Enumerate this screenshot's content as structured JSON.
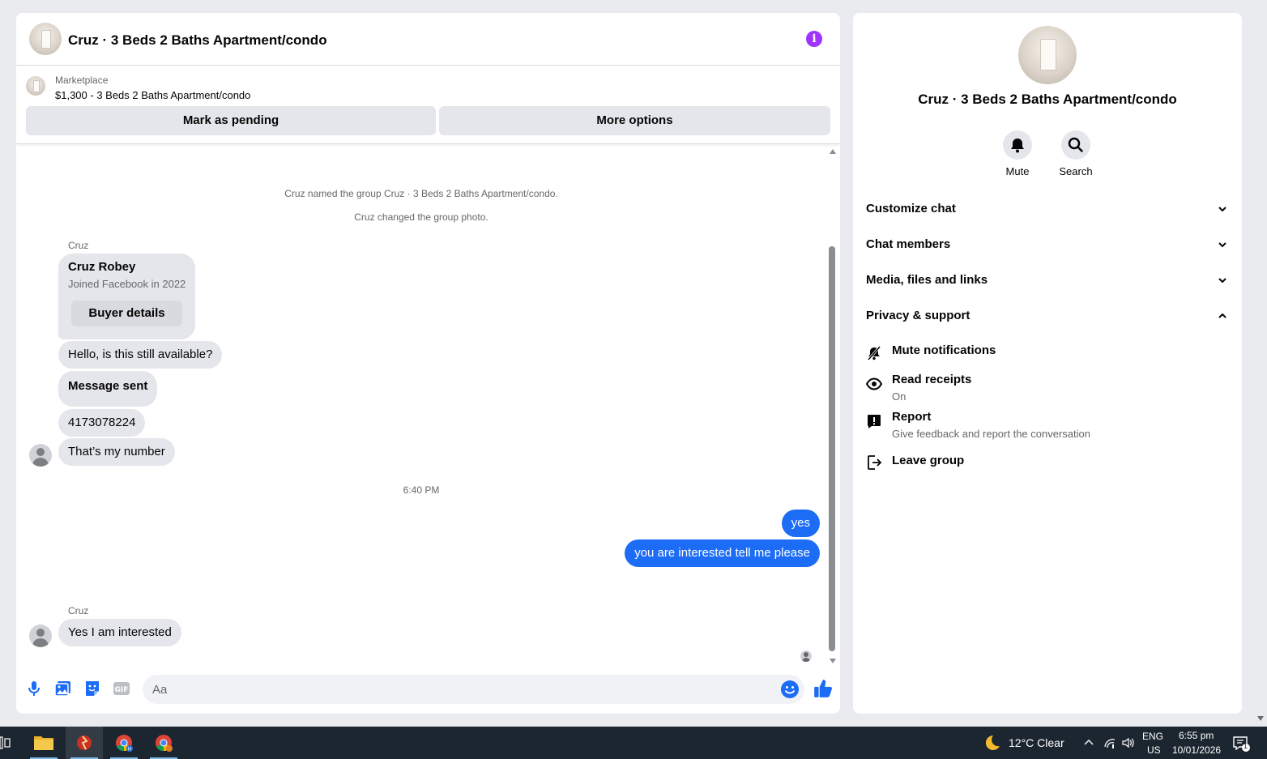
{
  "chat": {
    "title": "Cruz · 3 Beds 2 Baths Apartment/condo",
    "marketplace_label": "Marketplace",
    "listing": "$1,300 - 3 Beds 2 Baths Apartment/condo",
    "mark_pending_label": "Mark as pending",
    "more_options_label": "More options",
    "system_messages": [
      "Cruz named the group Cruz · 3 Beds 2 Baths Apartment/condo.",
      "Cruz changed the group photo."
    ],
    "sender_name": "Cruz",
    "profile_card": {
      "name": "Cruz Robey",
      "joined": "Joined Facebook in 2022",
      "button": "Buyer details"
    },
    "incoming_messages": [
      "Hello, is this still available?",
      "Message sent",
      "4173078224",
      "That’s my number"
    ],
    "timestamp": "6:40 PM",
    "outgoing_messages": [
      "yes",
      "you are interested tell me please"
    ],
    "last_sender_name": "Cruz",
    "last_message": "Yes I am interested",
    "composer_placeholder": "Aa"
  },
  "info_panel": {
    "title": "Cruz · 3 Beds 2 Baths Apartment/condo",
    "mute_label": "Mute",
    "search_label": "Search",
    "sections": [
      "Customize chat",
      "Chat members",
      "Media, files and links",
      "Privacy & support"
    ],
    "support_items": {
      "mute_notifications": "Mute notifications",
      "read_receipts": "Read receipts",
      "read_receipts_value": "On",
      "report": "Report",
      "report_desc": "Give feedback and report the conversation",
      "leave_group": "Leave group"
    }
  },
  "taskbar": {
    "weather": "12°C  Clear",
    "lang": "ENG",
    "region": "US",
    "time": "6:55 pm",
    "date": "10/01/2026",
    "notifications": "1"
  },
  "colors": {
    "accent": "#1d6cf5",
    "info_icon": "#a033ff",
    "bubble_in": "#e4e6eb",
    "taskbar": "#1c2630"
  }
}
